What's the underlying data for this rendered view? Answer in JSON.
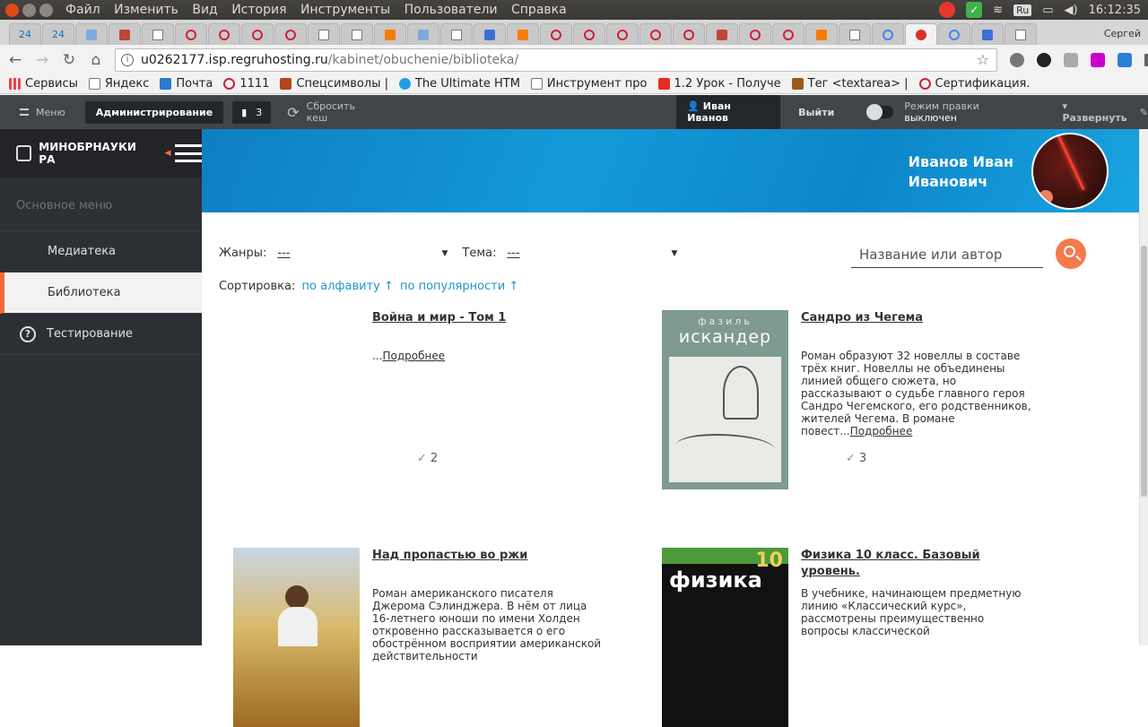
{
  "os": {
    "menu": [
      "Файл",
      "Изменить",
      "Вид",
      "История",
      "Инструменты",
      "Пользователи",
      "Справка"
    ],
    "keyboard": "Ru",
    "time": "16:12:35"
  },
  "browser": {
    "tab_labels": [
      "24",
      "24"
    ],
    "user": "Сергей",
    "url_host": "u0262177.isp.regruhosting.ru",
    "url_path": "/kabinet/obuchenie/biblioteka/",
    "bookmarks": [
      {
        "label": "Сервисы",
        "icon": "apps-icon"
      },
      {
        "label": "Яндекс",
        "icon": "page-icon"
      },
      {
        "label": "Почта",
        "icon": "mail-icon"
      },
      {
        "label": "1111",
        "icon": "opera-icon"
      },
      {
        "label": "Спецсимволы | ",
        "icon": "site-icon"
      },
      {
        "label": "The Ultimate HTM",
        "icon": "globe-icon"
      },
      {
        "label": "Инструмент про",
        "icon": "page-icon"
      },
      {
        "label": "1.2 Урок - Получе",
        "icon": "youtube-icon"
      },
      {
        "label": "Тег <textarea> | ",
        "icon": "site-icon"
      },
      {
        "label": "Сертификация.",
        "icon": "opera-icon"
      }
    ]
  },
  "cms": {
    "menu": "Меню",
    "admin": "Администрирование",
    "badge_count": "3",
    "reset_cache": "Сбросить кеш",
    "user": "Иван Иванов",
    "logout": "Выйти",
    "edit_mode_label": "Режим правки",
    "edit_mode_state": "выключен",
    "expand": "Развернуть"
  },
  "sidebar": {
    "logo": "МИНОБРНАУКИ РА",
    "section": "Основное меню",
    "items": [
      {
        "label": "Медиатека",
        "active": false
      },
      {
        "label": "Библиотека",
        "active": true
      },
      {
        "label": "Тестирование",
        "active": false
      }
    ]
  },
  "hero": {
    "name_line1": "Иванов Иван",
    "name_line2": "Иванович"
  },
  "filters": {
    "genres_label": "Жанры:",
    "genres_value": "---",
    "theme_label": "Тема:",
    "theme_value": "---",
    "search_placeholder": "Название или автор",
    "sort_label": "Сортировка:",
    "sort_alpha": "по алфавиту ↑",
    "sort_popular": "по популярности ↑"
  },
  "books": [
    {
      "title": "Война и мир - Том 1",
      "desc": "...",
      "more": "Подробнее",
      "count": "2"
    },
    {
      "title": "Сандро из Чегема",
      "desc": "Роман образуют 32 новеллы в составе трёх книг. Новеллы не объединены линией общего сюжета, но рассказывают о судьбе главного героя Сандро Чегемского, его родственников, жителей Чегема. В романе повест...",
      "more": "Подробнее",
      "count": "3",
      "cover_author": "фазиль",
      "cover_title": "искандер"
    },
    {
      "title": "Над пропастью во ржи",
      "desc": "Роман американского писателя Джерома Сэлинджера. В нём от лица 16-летнего юноши по имени Холден откровенно рассказывается о его обострённом восприятии американской действительности"
    },
    {
      "title": "Физика 10 класс. Базовый уровень.",
      "desc": "В учебнике, начинающем предметную линию «Классический курс», рассмотрены преимущественно вопросы классической",
      "cover_title": "физика",
      "cover_num": "10"
    }
  ]
}
